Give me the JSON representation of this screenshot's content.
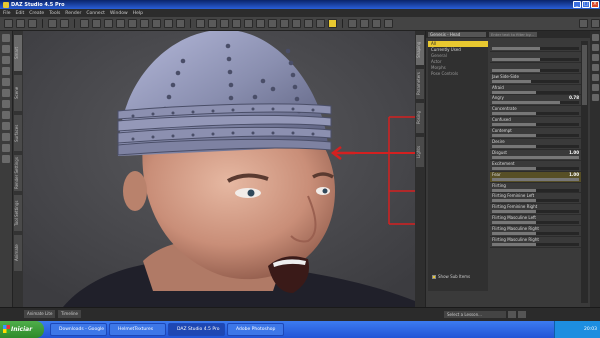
{
  "window": {
    "title": "DAZ Studio 4.5 Pro"
  },
  "menu": [
    "File",
    "Edit",
    "Create",
    "Tools",
    "Render",
    "Connect",
    "Window",
    "Help"
  ],
  "left_tabs": [
    "Smart",
    "Scene",
    "Surfaces",
    "Render Settings",
    "Tool Settings",
    "Animate"
  ],
  "right_tabs": [
    "Shaping",
    "Parameters",
    "Posing",
    "Lights"
  ],
  "panel": {
    "filter_label": "Genesis - Head",
    "search_placeholder": "Enter text to filter by...",
    "categories": [
      {
        "label": "All",
        "selected": true
      },
      {
        "label": "Currently Used",
        "selected": false
      },
      {
        "label": "General",
        "selected": false
      },
      {
        "label": "Actor",
        "selected": false
      },
      {
        "label": "Morphs",
        "selected": false
      },
      {
        "label": "Pose Controls",
        "selected": false
      }
    ],
    "show_sub_items": "Show Sub Items",
    "sliders": [
      {
        "label": "",
        "value": "",
        "fill": 0.55
      },
      {
        "label": "",
        "value": "",
        "fill": 0.55
      },
      {
        "label": "",
        "value": "",
        "fill": 0.55
      },
      {
        "label": "Jaw Side-Side",
        "value": "",
        "fill": 0.45
      },
      {
        "label": "Afraid",
        "value": "",
        "fill": 0.5
      },
      {
        "label": "Angry",
        "value": "0.78",
        "fill": 0.78
      },
      {
        "label": "Concentrate",
        "value": "",
        "fill": 0.5
      },
      {
        "label": "Confused",
        "value": "",
        "fill": 0.5
      },
      {
        "label": "Contempt",
        "value": "",
        "fill": 0.5
      },
      {
        "label": "Desire",
        "value": "",
        "fill": 0.5
      },
      {
        "label": "Disgust",
        "value": "1.00",
        "fill": 1.0
      },
      {
        "label": "Excitement",
        "value": "",
        "fill": 0.5
      },
      {
        "label": "Fear",
        "value": "1.00",
        "fill": 1.0
      },
      {
        "label": "Flirting",
        "value": "",
        "fill": 0.5
      },
      {
        "label": "Flirting Feminine Left",
        "value": "",
        "fill": 0.5
      },
      {
        "label": "Flirting Feminine Right",
        "value": "",
        "fill": 0.5
      },
      {
        "label": "Flirting Masculine Left",
        "value": "",
        "fill": 0.5
      },
      {
        "label": "Flirting Masculine Right",
        "value": "",
        "fill": 0.5
      },
      {
        "label": "Flirting Masculine Right",
        "value": "",
        "fill": 0.5
      }
    ]
  },
  "bottom": {
    "tabs": [
      "Animate Lite",
      "Timeline"
    ],
    "lesson_placeholder": "Select a Lesson..."
  },
  "taskbar": {
    "start_label": "Iniciar",
    "tasks": [
      {
        "label": "Downloads - Google ...",
        "active": false
      },
      {
        "label": "HelmetTextures",
        "active": false
      },
      {
        "label": "DAZ Studio 4.5 Pro",
        "active": true
      },
      {
        "label": "Adobe Photoshop",
        "active": false
      }
    ],
    "clock": "20:03"
  },
  "colors": {
    "accent": "#e8c830",
    "annotation": "#d42020",
    "helmet": "#8a8fb0"
  }
}
